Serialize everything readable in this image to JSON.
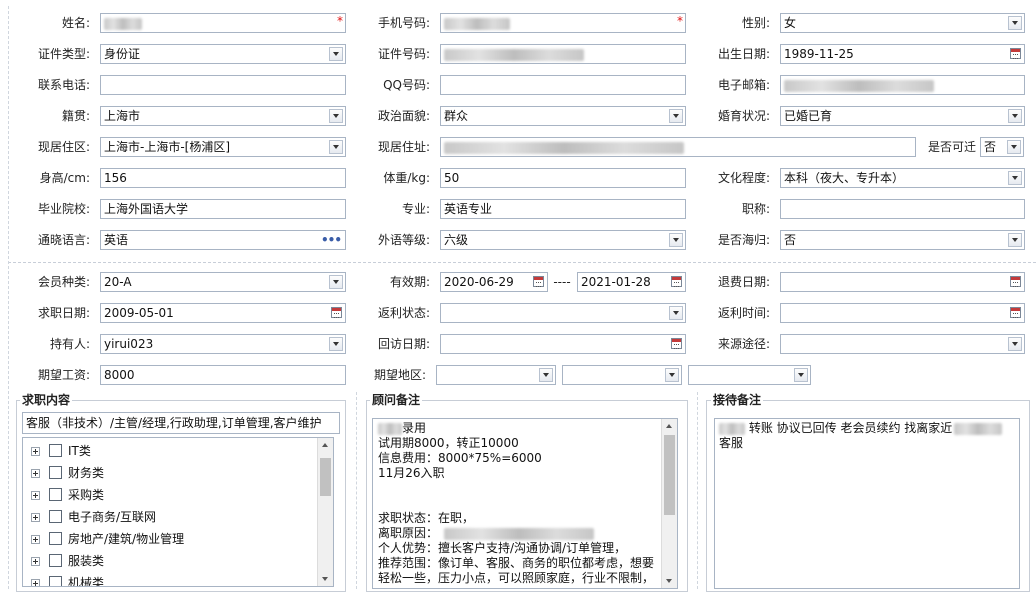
{
  "form": {
    "name": {
      "label": "姓名:",
      "value": ""
    },
    "mobile": {
      "label": "手机号码:",
      "value": ""
    },
    "gender": {
      "label": "性别:",
      "value": "女"
    },
    "id_type": {
      "label": "证件类型:",
      "value": "身份证"
    },
    "id_number": {
      "label": "证件号码:",
      "value": ""
    },
    "birth_date": {
      "label": "出生日期:",
      "value": "1989-11-25"
    },
    "contact_phone": {
      "label": "联系电话:",
      "value": ""
    },
    "qq": {
      "label": "QQ号码:",
      "value": ""
    },
    "email": {
      "label": "电子邮箱:",
      "value": ""
    },
    "native_place": {
      "label": "籍贯:",
      "value": "上海市"
    },
    "political_status": {
      "label": "政治面貌:",
      "value": "群众"
    },
    "marital_status": {
      "label": "婚育状况:",
      "value": "已婚已育"
    },
    "residence_area": {
      "label": "现居住区:",
      "value": "上海市-上海市-[杨浦区]"
    },
    "residence_address": {
      "label": "现居住址:",
      "value": ""
    },
    "relocatable": {
      "label": "是否可迁",
      "value": "否"
    },
    "height": {
      "label": "身高/cm:",
      "value": "156"
    },
    "weight": {
      "label": "体重/kg:",
      "value": "50"
    },
    "education": {
      "label": "文化程度:",
      "value": "本科（夜大、专升本）"
    },
    "school": {
      "label": "毕业院校:",
      "value": "上海外国语大学"
    },
    "major": {
      "label": "专业:",
      "value": "英语专业"
    },
    "title": {
      "label": "职称:",
      "value": ""
    },
    "language": {
      "label": "通晓语言:",
      "value": "英语"
    },
    "language_level": {
      "label": "外语等级:",
      "value": "六级"
    },
    "overseas": {
      "label": "是否海归:",
      "value": "否"
    }
  },
  "membership": {
    "member_type": {
      "label": "会员种类:",
      "value": "20-A"
    },
    "valid_period": {
      "label": "有效期:",
      "start": "2020-06-29",
      "separator": "----",
      "end": "2021-01-28"
    },
    "refund_date": {
      "label": "退费日期:",
      "value": ""
    },
    "job_seek_date": {
      "label": "求职日期:",
      "value": "2009-05-01"
    },
    "rebate_status": {
      "label": "返利状态:",
      "value": ""
    },
    "rebate_time": {
      "label": "返利时间:",
      "value": ""
    },
    "holder": {
      "label": "持有人:",
      "value": "yirui023"
    },
    "visit_date": {
      "label": "回访日期:",
      "value": ""
    },
    "source": {
      "label": "来源途径:",
      "value": ""
    },
    "expected_salary": {
      "label": "期望工资:",
      "value": "8000"
    },
    "expected_region": {
      "label": "期望地区:",
      "values": [
        "",
        "",
        ""
      ]
    }
  },
  "job_panel": {
    "title": "求职内容",
    "summary": "客服（非技术）/主管/经理,行政助理,订单管理,客户维护",
    "tree": [
      "IT类",
      "财务类",
      "采购类",
      "电子商务/互联网",
      "房地产/建筑/物业管理",
      "服装类",
      "机械类"
    ]
  },
  "advisor_panel": {
    "title": "顾问备注",
    "lines": [
      {
        "pre": "",
        "text": "录用",
        "blur": true
      },
      {
        "pre": "",
        "text": "试用期8000，转正10000"
      },
      {
        "pre": "",
        "text": "信息费用：8000*75%=6000"
      },
      {
        "pre": "",
        "text": "11月26入职"
      },
      {
        "pre": "",
        "text": ""
      },
      {
        "pre": "",
        "text": ""
      },
      {
        "pre": "",
        "text": "求职状态：在职，"
      },
      {
        "pre": "",
        "text": "离职原因："
      },
      {
        "pre": "",
        "text": "个人优势：擅长客户支持/沟通协调/订单管理，"
      },
      {
        "pre": "",
        "text": "推荐范围：像订单、客服、商务的职位都考虑，想要"
      },
      {
        "pre": "",
        "text": "轻松一些，压力小点，可以照顾家庭，行业不限制，"
      }
    ]
  },
  "reception_panel": {
    "title": "接待备注",
    "text_a": "转账 协议已回传 老会员续约 找离家近",
    "text_b": "客服"
  }
}
